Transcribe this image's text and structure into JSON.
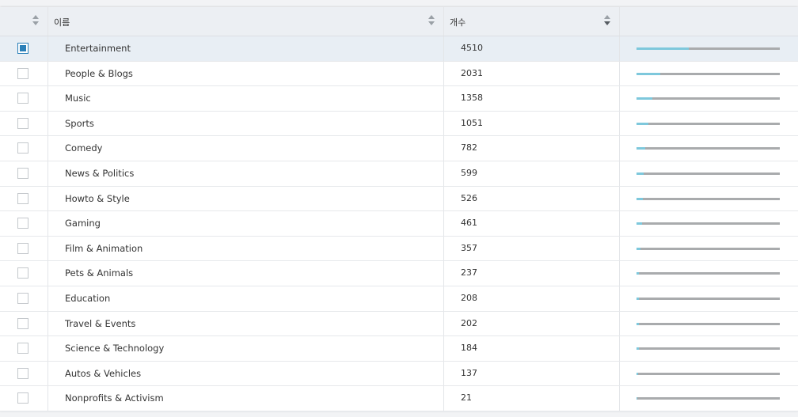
{
  "table": {
    "columns": [
      {
        "label": ""
      },
      {
        "label": "이름"
      },
      {
        "label": "개수"
      },
      {
        "label": ""
      }
    ],
    "max_count": 12400,
    "rows": [
      {
        "name": "Entertainment",
        "count": 4510,
        "selected": true
      },
      {
        "name": "People & Blogs",
        "count": 2031,
        "selected": false
      },
      {
        "name": "Music",
        "count": 1358,
        "selected": false
      },
      {
        "name": "Sports",
        "count": 1051,
        "selected": false
      },
      {
        "name": "Comedy",
        "count": 782,
        "selected": false
      },
      {
        "name": "News & Politics",
        "count": 599,
        "selected": false
      },
      {
        "name": "Howto & Style",
        "count": 526,
        "selected": false
      },
      {
        "name": "Gaming",
        "count": 461,
        "selected": false
      },
      {
        "name": "Film & Animation",
        "count": 357,
        "selected": false
      },
      {
        "name": "Pets & Animals",
        "count": 237,
        "selected": false
      },
      {
        "name": "Education",
        "count": 208,
        "selected": false
      },
      {
        "name": "Travel & Events",
        "count": 202,
        "selected": false
      },
      {
        "name": "Science & Technology",
        "count": 184,
        "selected": false
      },
      {
        "name": "Autos & Vehicles",
        "count": 137,
        "selected": false
      },
      {
        "name": "Nonprofits & Activism",
        "count": 21,
        "selected": false
      }
    ]
  },
  "colors": {
    "bar_fill": "#7ec8dc",
    "bar_track": "#a9abad",
    "checkbox_checked": "#2a7fb8",
    "selected_row": "#e8eef4"
  }
}
